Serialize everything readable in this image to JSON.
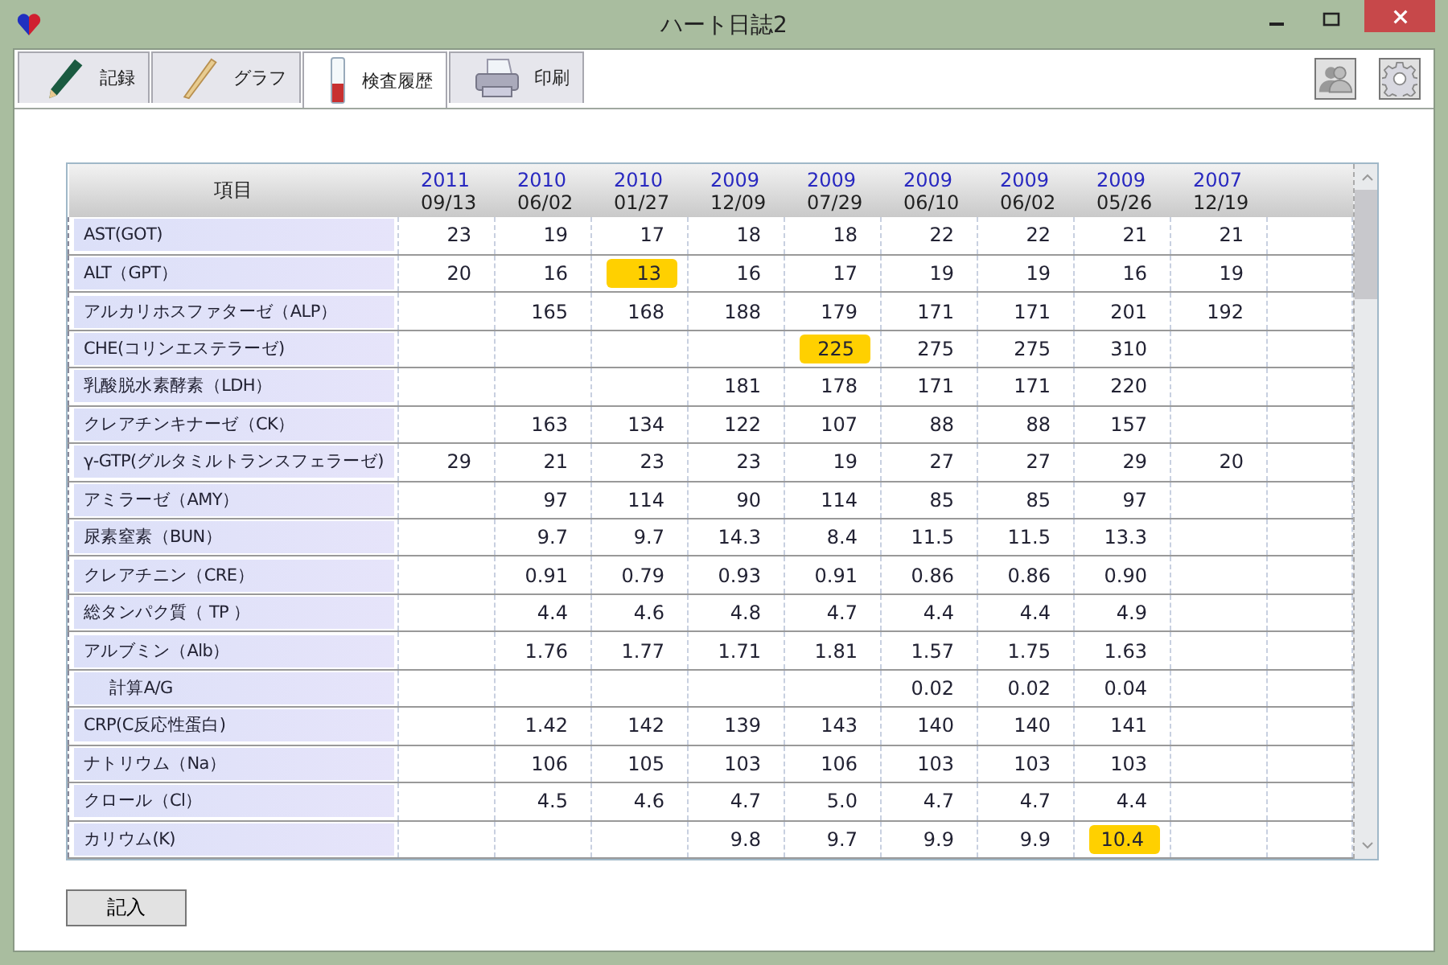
{
  "window": {
    "title": "ハート日誌2"
  },
  "tabs": [
    {
      "label": "記録",
      "selected": false
    },
    {
      "label": "グラフ",
      "selected": false
    },
    {
      "label": "検査履歴",
      "selected": true
    },
    {
      "label": "印刷",
      "selected": false
    }
  ],
  "table": {
    "item_header": "項目",
    "columns": [
      {
        "year": "2011",
        "date": "09/13"
      },
      {
        "year": "2010",
        "date": "06/02"
      },
      {
        "year": "2010",
        "date": "01/27"
      },
      {
        "year": "2009",
        "date": "12/09"
      },
      {
        "year": "2009",
        "date": "07/29"
      },
      {
        "year": "2009",
        "date": "06/10"
      },
      {
        "year": "2009",
        "date": "06/02"
      },
      {
        "year": "2009",
        "date": "05/26"
      },
      {
        "year": "2007",
        "date": "12/19"
      }
    ],
    "rows": [
      {
        "label": "AST(GOT)",
        "kind": "item",
        "cells": [
          {
            "value": "23",
            "highlighted": false
          },
          {
            "value": "19",
            "highlighted": false
          },
          {
            "value": "17",
            "highlighted": false
          },
          {
            "value": "18",
            "highlighted": false
          },
          {
            "value": "18",
            "highlighted": false
          },
          {
            "value": "22",
            "highlighted": false
          },
          {
            "value": "22",
            "highlighted": false
          },
          {
            "value": "21",
            "highlighted": false
          },
          {
            "value": "21",
            "highlighted": false
          }
        ]
      },
      {
        "label": "ALT（GPT）",
        "kind": "item",
        "cells": [
          {
            "value": "20",
            "highlighted": false
          },
          {
            "value": "16",
            "highlighted": false
          },
          {
            "value": "13",
            "highlighted": true
          },
          {
            "value": "16",
            "highlighted": false
          },
          {
            "value": "17",
            "highlighted": false
          },
          {
            "value": "19",
            "highlighted": false
          },
          {
            "value": "19",
            "highlighted": false
          },
          {
            "value": "16",
            "highlighted": false
          },
          {
            "value": "19",
            "highlighted": false
          }
        ]
      },
      {
        "label": "アルカリホスファターゼ（ALP）",
        "kind": "item",
        "cells": [
          null,
          {
            "value": "165",
            "highlighted": false
          },
          {
            "value": "168",
            "highlighted": false
          },
          {
            "value": "188",
            "highlighted": false
          },
          {
            "value": "179",
            "highlighted": false
          },
          {
            "value": "171",
            "highlighted": false
          },
          {
            "value": "171",
            "highlighted": false
          },
          {
            "value": "201",
            "highlighted": false
          },
          {
            "value": "192",
            "highlighted": false
          }
        ]
      },
      {
        "label": "CHE(コリンエステラーゼ)",
        "kind": "item",
        "cells": [
          null,
          null,
          null,
          null,
          {
            "value": "225",
            "highlighted": true
          },
          {
            "value": "275",
            "highlighted": false
          },
          {
            "value": "275",
            "highlighted": false
          },
          {
            "value": "310",
            "highlighted": false
          },
          null
        ]
      },
      {
        "label": "乳酸脱水素酵素（LDH）",
        "kind": "item",
        "cells": [
          null,
          null,
          null,
          {
            "value": "181",
            "highlighted": false
          },
          {
            "value": "178",
            "highlighted": false
          },
          {
            "value": "171",
            "highlighted": false
          },
          {
            "value": "171",
            "highlighted": false
          },
          {
            "value": "220",
            "highlighted": false
          },
          null
        ]
      },
      {
        "label": "クレアチンキナーゼ（CK）",
        "kind": "item",
        "cells": [
          null,
          {
            "value": "163",
            "highlighted": false
          },
          {
            "value": "134",
            "highlighted": false
          },
          {
            "value": "122",
            "highlighted": false
          },
          {
            "value": "107",
            "highlighted": false
          },
          {
            "value": "88",
            "highlighted": false
          },
          {
            "value": "88",
            "highlighted": false
          },
          {
            "value": "157",
            "highlighted": false
          },
          null
        ]
      },
      {
        "label": "γ-GTP(グルタミルトランスフェラーゼ)",
        "kind": "item",
        "cells": [
          {
            "value": "29",
            "highlighted": false
          },
          {
            "value": "21",
            "highlighted": false
          },
          {
            "value": "23",
            "highlighted": false
          },
          {
            "value": "23",
            "highlighted": false
          },
          {
            "value": "19",
            "highlighted": false
          },
          {
            "value": "27",
            "highlighted": false
          },
          {
            "value": "27",
            "highlighted": false
          },
          {
            "value": "29",
            "highlighted": false
          },
          {
            "value": "20",
            "highlighted": false
          }
        ]
      },
      {
        "label": "アミラーゼ（AMY）",
        "kind": "item",
        "cells": [
          null,
          {
            "value": "97",
            "highlighted": false
          },
          {
            "value": "114",
            "highlighted": false
          },
          {
            "value": "90",
            "highlighted": false
          },
          {
            "value": "114",
            "highlighted": false
          },
          {
            "value": "85",
            "highlighted": false
          },
          {
            "value": "85",
            "highlighted": false
          },
          {
            "value": "97",
            "highlighted": false
          },
          null
        ]
      },
      {
        "label": "尿素窒素（BUN）",
        "kind": "item",
        "cells": [
          null,
          {
            "value": "9.7",
            "highlighted": false
          },
          {
            "value": "9.7",
            "highlighted": false
          },
          {
            "value": "14.3",
            "highlighted": false
          },
          {
            "value": "8.4",
            "highlighted": false
          },
          {
            "value": "11.5",
            "highlighted": false
          },
          {
            "value": "11.5",
            "highlighted": false
          },
          {
            "value": "13.3",
            "highlighted": false
          },
          null
        ]
      },
      {
        "label": "クレアチニン（CRE）",
        "kind": "item",
        "cells": [
          null,
          {
            "value": "0.91",
            "highlighted": false
          },
          {
            "value": "0.79",
            "highlighted": false
          },
          {
            "value": "0.93",
            "highlighted": false
          },
          {
            "value": "0.91",
            "highlighted": false
          },
          {
            "value": "0.86",
            "highlighted": false
          },
          {
            "value": "0.86",
            "highlighted": false
          },
          {
            "value": "0.90",
            "highlighted": false
          },
          null
        ]
      },
      {
        "label": "総タンパク質（ TP ）",
        "kind": "item",
        "cells": [
          null,
          {
            "value": "4.4",
            "highlighted": false
          },
          {
            "value": "4.6",
            "highlighted": false
          },
          {
            "value": "4.8",
            "highlighted": false
          },
          {
            "value": "4.7",
            "highlighted": false
          },
          {
            "value": "4.4",
            "highlighted": false
          },
          {
            "value": "4.4",
            "highlighted": false
          },
          {
            "value": "4.9",
            "highlighted": false
          },
          null
        ]
      },
      {
        "label": "アルブミン（Alb）",
        "kind": "item",
        "cells": [
          null,
          {
            "value": "1.76",
            "highlighted": false
          },
          {
            "value": "1.77",
            "highlighted": false
          },
          {
            "value": "1.71",
            "highlighted": false
          },
          {
            "value": "1.81",
            "highlighted": false
          },
          {
            "value": "1.57",
            "highlighted": false
          },
          {
            "value": "1.75",
            "highlighted": false
          },
          {
            "value": "1.63",
            "highlighted": false
          },
          null
        ]
      },
      {
        "label": "計算A/G",
        "kind": "derived",
        "cells": [
          null,
          null,
          null,
          null,
          null,
          {
            "value": "0.02",
            "highlighted": false
          },
          {
            "value": "0.02",
            "highlighted": false
          },
          {
            "value": "0.04",
            "highlighted": false
          },
          null
        ]
      },
      {
        "label": "CRP(C反応性蛋白)",
        "kind": "item",
        "cells": [
          null,
          {
            "value": "1.42",
            "highlighted": false
          },
          {
            "value": "142",
            "highlighted": false
          },
          {
            "value": "139",
            "highlighted": false
          },
          {
            "value": "143",
            "highlighted": false
          },
          {
            "value": "140",
            "highlighted": false
          },
          {
            "value": "140",
            "highlighted": false
          },
          {
            "value": "141",
            "highlighted": false
          },
          null
        ]
      },
      {
        "label": "ナトリウム（Na）",
        "kind": "item",
        "cells": [
          null,
          {
            "value": "106",
            "highlighted": false
          },
          {
            "value": "105",
            "highlighted": false
          },
          {
            "value": "103",
            "highlighted": false
          },
          {
            "value": "106",
            "highlighted": false
          },
          {
            "value": "103",
            "highlighted": false
          },
          {
            "value": "103",
            "highlighted": false
          },
          {
            "value": "103",
            "highlighted": false
          },
          null
        ]
      },
      {
        "label": "クロール（Cl）",
        "kind": "item",
        "cells": [
          null,
          {
            "value": "4.5",
            "highlighted": false
          },
          {
            "value": "4.6",
            "highlighted": false
          },
          {
            "value": "4.7",
            "highlighted": false
          },
          {
            "value": "5.0",
            "highlighted": false
          },
          {
            "value": "4.7",
            "highlighted": false
          },
          {
            "value": "4.7",
            "highlighted": false
          },
          {
            "value": "4.4",
            "highlighted": false
          },
          null
        ]
      },
      {
        "label": "カリウム(K)",
        "kind": "item",
        "cells": [
          null,
          null,
          null,
          {
            "value": "9.8",
            "highlighted": false
          },
          {
            "value": "9.7",
            "highlighted": false
          },
          {
            "value": "9.9",
            "highlighted": false
          },
          {
            "value": "9.9",
            "highlighted": false
          },
          {
            "value": "10.4",
            "highlighted": true
          },
          null
        ]
      }
    ]
  },
  "buttons": [
    {
      "label": "記入"
    }
  ]
}
